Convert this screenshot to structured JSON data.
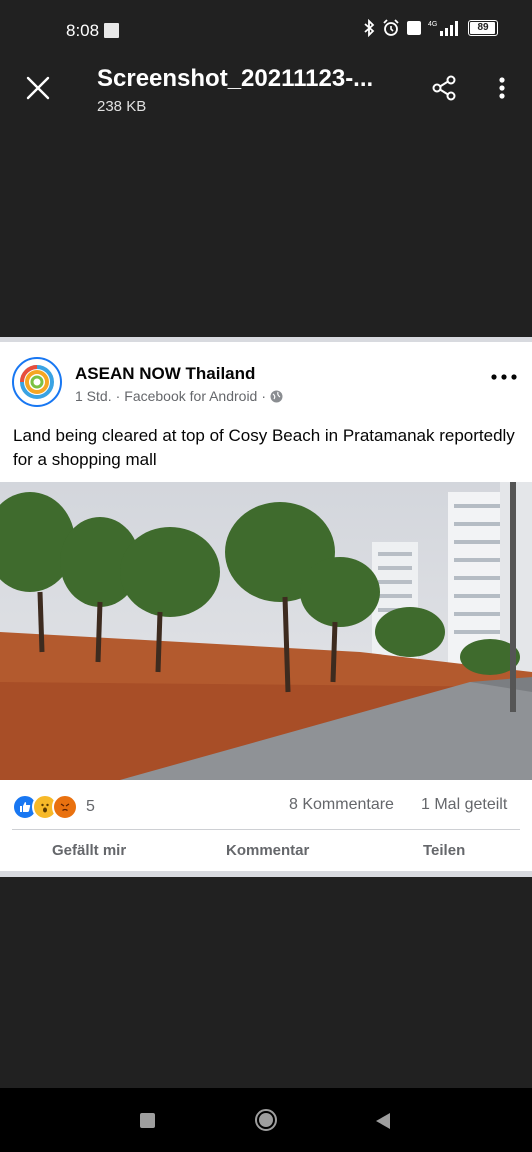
{
  "status_bar": {
    "time": "8:08",
    "battery": "89"
  },
  "viewer": {
    "file_title": "Screenshot_20211123-...",
    "file_size": "238 KB"
  },
  "post": {
    "page_name": "ASEAN NOW Thailand",
    "time_ago": "1 Std.",
    "source": "Facebook for Android",
    "separator": "·",
    "text": "Land being cleared at top of Cosy Beach in Pratamanak reportedly for a shopping mall",
    "reaction_count": "5",
    "comments": "8 Kommentare",
    "shares": "1 Mal geteilt",
    "actions": {
      "like": "Gefällt mir",
      "comment": "Kommentar",
      "share": "Teilen"
    }
  },
  "colors": {
    "viewer_bg": "#212121",
    "card_bg": "#ffffff",
    "fb_blue": "#1877f2",
    "meta_gray": "#65676b"
  },
  "icons": [
    "close-icon",
    "share-icon",
    "more-vertical-icon",
    "more-horizontal-icon",
    "globe-icon",
    "like-reaction-icon",
    "wow-reaction-icon",
    "angry-reaction-icon",
    "bluetooth-icon",
    "alarm-icon",
    "signal-icon",
    "battery-icon",
    "nav-recents-icon",
    "nav-home-icon",
    "nav-back-icon"
  ]
}
